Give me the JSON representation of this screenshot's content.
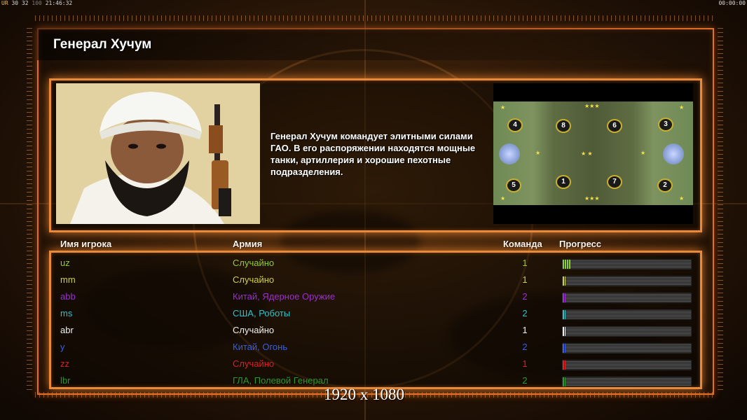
{
  "hud": {
    "left_prefix": "UR",
    "left_a": "30",
    "left_b": "32",
    "left_c": "100",
    "time": "21:46:32",
    "right_time": "00:00:00"
  },
  "title": "Генерал Хучум",
  "description": "Генерал Хучум командует элитными силами ГАО. В его распоряжении находятся мощные танки, артиллерия и хорошие пехотные подразделения.",
  "minimap": {
    "slots": [
      "4",
      "8",
      "6",
      "3",
      "5",
      "1",
      "7",
      "2"
    ]
  },
  "columns": {
    "player_name": "Имя игрока",
    "army": "Армия",
    "team": "Команда",
    "progress": "Прогресс"
  },
  "players": [
    {
      "name": "uz",
      "army": "Случайно",
      "team": "1",
      "color": "#8ecf2e",
      "progress": 0.06
    },
    {
      "name": "mm",
      "army": "Случайно",
      "team": "1",
      "color": "#d0d040",
      "progress": 0.02
    },
    {
      "name": "abb",
      "army": "Китай, Ядерное Оружие",
      "team": "2",
      "color": "#9b2fd0",
      "progress": 0.02
    },
    {
      "name": "ms",
      "army": "США, Роботы",
      "team": "2",
      "color": "#2fc2c8",
      "progress": 0.02
    },
    {
      "name": "abr",
      "army": "Случайно",
      "team": "1",
      "color": "#f0f0f0",
      "progress": 0.02
    },
    {
      "name": "y",
      "army": "Китай, Огонь",
      "team": "2",
      "color": "#3a5fe0",
      "progress": 0.02
    },
    {
      "name": "zz",
      "army": "Случайно",
      "team": "1",
      "color": "#e02020",
      "progress": 0.02
    },
    {
      "name": "lbr",
      "army": "ГЛА, Полевой Генерал",
      "team": "2",
      "color": "#2a9a2a",
      "progress": 0.02
    }
  ],
  "resolution_label": "1920 x 1080"
}
